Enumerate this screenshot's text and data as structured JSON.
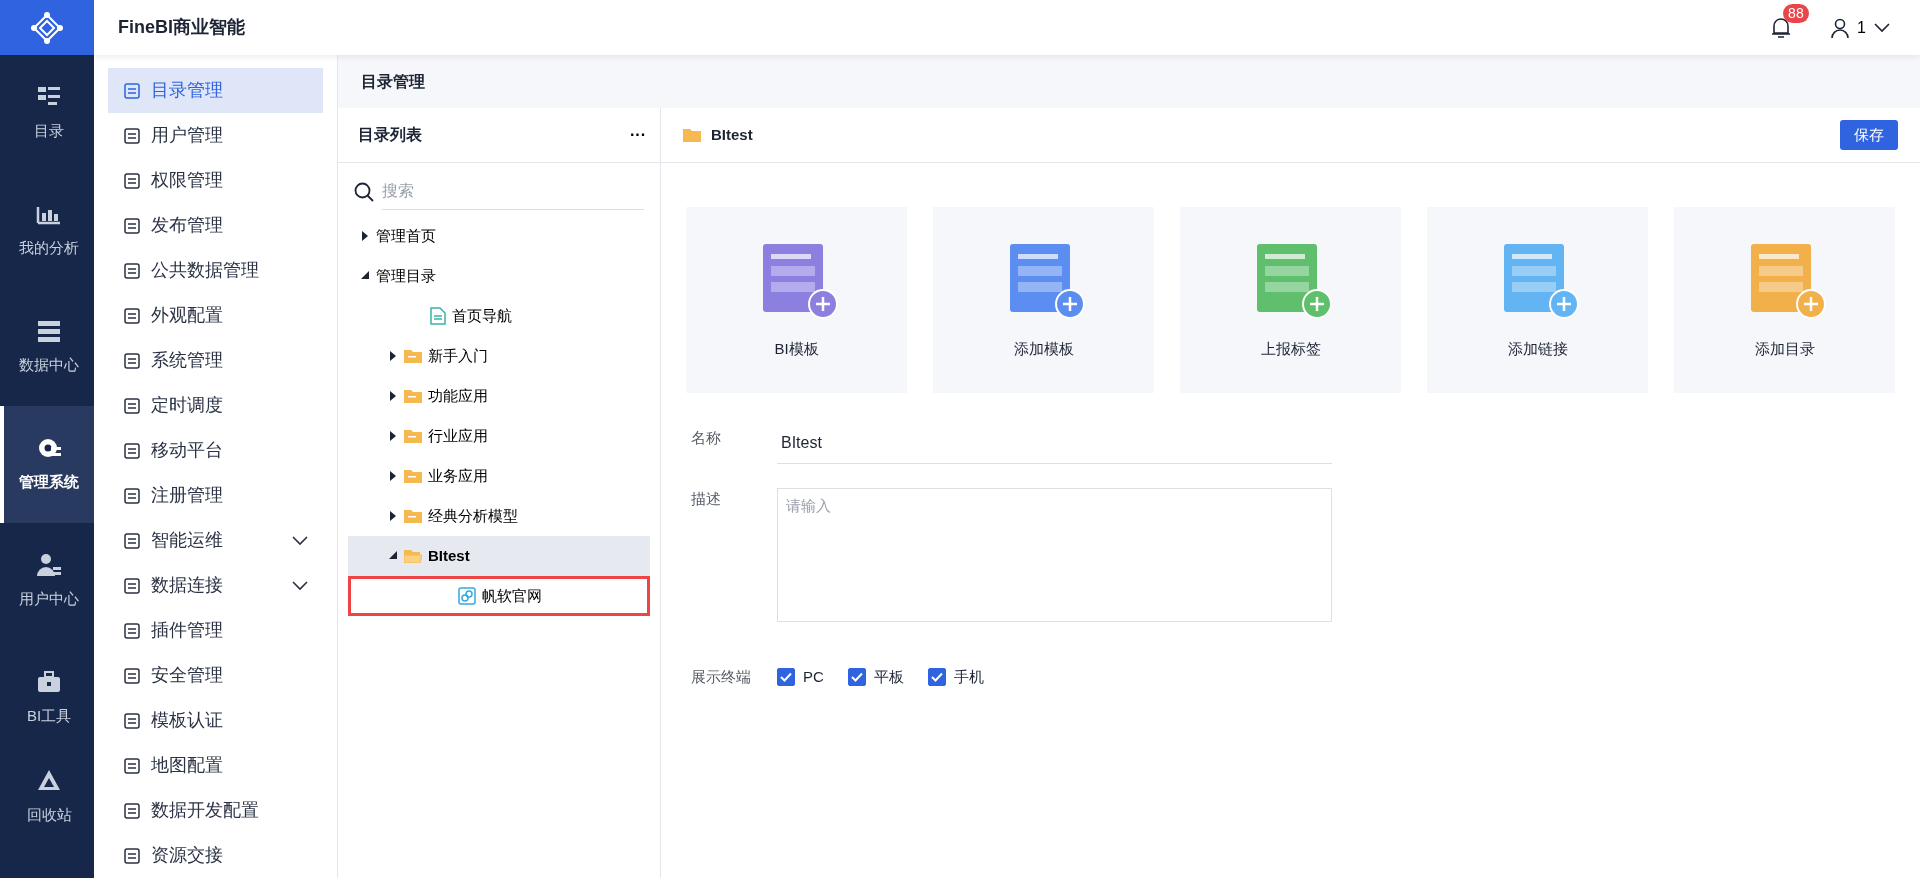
{
  "app": {
    "title": "FineBI商业智能",
    "notifications": "88",
    "user": "1"
  },
  "nav": [
    {
      "label": "目录",
      "selected": false
    },
    {
      "label": "我的分析",
      "selected": false
    },
    {
      "label": "数据中心",
      "selected": false
    },
    {
      "label": "管理系统",
      "selected": true
    },
    {
      "label": "用户中心",
      "selected": false
    },
    {
      "label": "BI工具",
      "selected": false
    },
    {
      "label": "回收站",
      "selected": false
    }
  ],
  "menu": [
    {
      "label": "目录管理",
      "selected": true,
      "expandable": false
    },
    {
      "label": "用户管理",
      "selected": false,
      "expandable": false
    },
    {
      "label": "权限管理",
      "selected": false,
      "expandable": false
    },
    {
      "label": "发布管理",
      "selected": false,
      "expandable": false
    },
    {
      "label": "公共数据管理",
      "selected": false,
      "expandable": false
    },
    {
      "label": "外观配置",
      "selected": false,
      "expandable": false
    },
    {
      "label": "系统管理",
      "selected": false,
      "expandable": false
    },
    {
      "label": "定时调度",
      "selected": false,
      "expandable": false
    },
    {
      "label": "移动平台",
      "selected": false,
      "expandable": false
    },
    {
      "label": "注册管理",
      "selected": false,
      "expandable": false
    },
    {
      "label": "智能运维",
      "selected": false,
      "expandable": true
    },
    {
      "label": "数据连接",
      "selected": false,
      "expandable": true
    },
    {
      "label": "插件管理",
      "selected": false,
      "expandable": false
    },
    {
      "label": "安全管理",
      "selected": false,
      "expandable": false
    },
    {
      "label": "模板认证",
      "selected": false,
      "expandable": false
    },
    {
      "label": "地图配置",
      "selected": false,
      "expandable": false
    },
    {
      "label": "数据开发配置",
      "selected": false,
      "expandable": false
    },
    {
      "label": "资源交接",
      "selected": false,
      "expandable": false
    }
  ],
  "page_title": "目录管理",
  "tree": {
    "title": "目录列表",
    "more": "···",
    "search": {
      "placeholder": "搜索"
    },
    "items": [
      {
        "label": "管理首页",
        "kind": "group",
        "expanded": false,
        "selected": false
      },
      {
        "label": "管理目录",
        "kind": "group",
        "expanded": true,
        "selected": false,
        "children": [
          {
            "label": "首页导航",
            "kind": "doc",
            "selected": false
          },
          {
            "label": "新手入门",
            "kind": "folder",
            "expanded": false,
            "selected": false
          },
          {
            "label": "功能应用",
            "kind": "folder",
            "expanded": false,
            "selected": false
          },
          {
            "label": "行业应用",
            "kind": "folder",
            "expanded": false,
            "selected": false
          },
          {
            "label": "业务应用",
            "kind": "folder",
            "expanded": false,
            "selected": false
          },
          {
            "label": "经典分析模型",
            "kind": "folder",
            "expanded": false,
            "selected": false
          },
          {
            "label": "BItest",
            "kind": "folder",
            "expanded": true,
            "selected": true,
            "children": [
              {
                "label": "帆软官网",
                "kind": "link",
                "selected": false,
                "highlighted": true
              }
            ]
          }
        ]
      }
    ]
  },
  "detail": {
    "title": "BItest",
    "save": "保存",
    "actions": [
      {
        "label": "BI模板",
        "color": "#8b7fe0"
      },
      {
        "label": "添加模板",
        "color": "#5b8ef0"
      },
      {
        "label": "上报标签",
        "color": "#5fbf6c"
      },
      {
        "label": "添加链接",
        "color": "#62b4f2"
      },
      {
        "label": "添加目录",
        "color": "#f2b04a"
      }
    ],
    "name_label": "名称",
    "name_value": "BItest",
    "desc_label": "描述",
    "desc_placeholder": "请输入",
    "terminals_label": "展示终端",
    "terminals": [
      {
        "label": "PC",
        "checked": true
      },
      {
        "label": "平板",
        "checked": true
      },
      {
        "label": "手机",
        "checked": true
      }
    ]
  }
}
